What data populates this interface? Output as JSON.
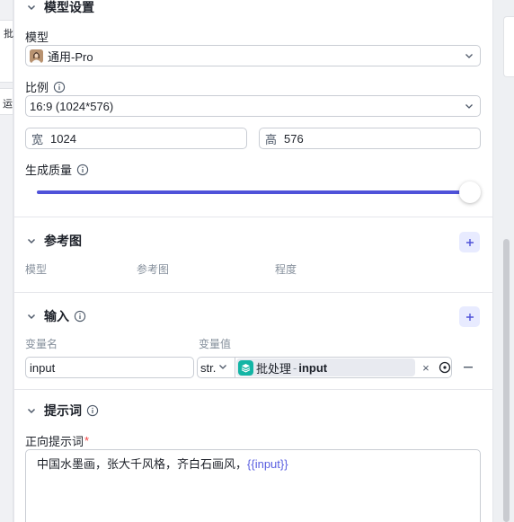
{
  "background": {
    "left_tags": [
      "批",
      "运"
    ],
    "accent": "#4f52d9"
  },
  "model_settings": {
    "title": "模型设置",
    "model_label": "模型",
    "model_value": "通用-Pro",
    "ratio_label": "比例",
    "ratio_value": "16:9 (1024*576)",
    "width_prefix": "宽",
    "width_value": "1024",
    "height_prefix": "高",
    "height_value": "576",
    "quality_label": "生成质量",
    "quality_level": 1.0
  },
  "reference_image": {
    "title": "参考图",
    "columns": [
      "模型",
      "参考图",
      "程度"
    ]
  },
  "input": {
    "title": "输入",
    "col_name": "变量名",
    "col_value": "变量值",
    "var_name": "input",
    "var_type": "str.",
    "ref_node": "批处理",
    "ref_sep": "-",
    "ref_var": "input",
    "clear_glyph": "×",
    "remove_glyph": "−"
  },
  "prompt": {
    "title": "提示词",
    "positive_label": "正向提示词",
    "required_mark": "*",
    "text": "中国水墨画，张大千风格，齐白石画风，",
    "variable": "{{input}}"
  }
}
